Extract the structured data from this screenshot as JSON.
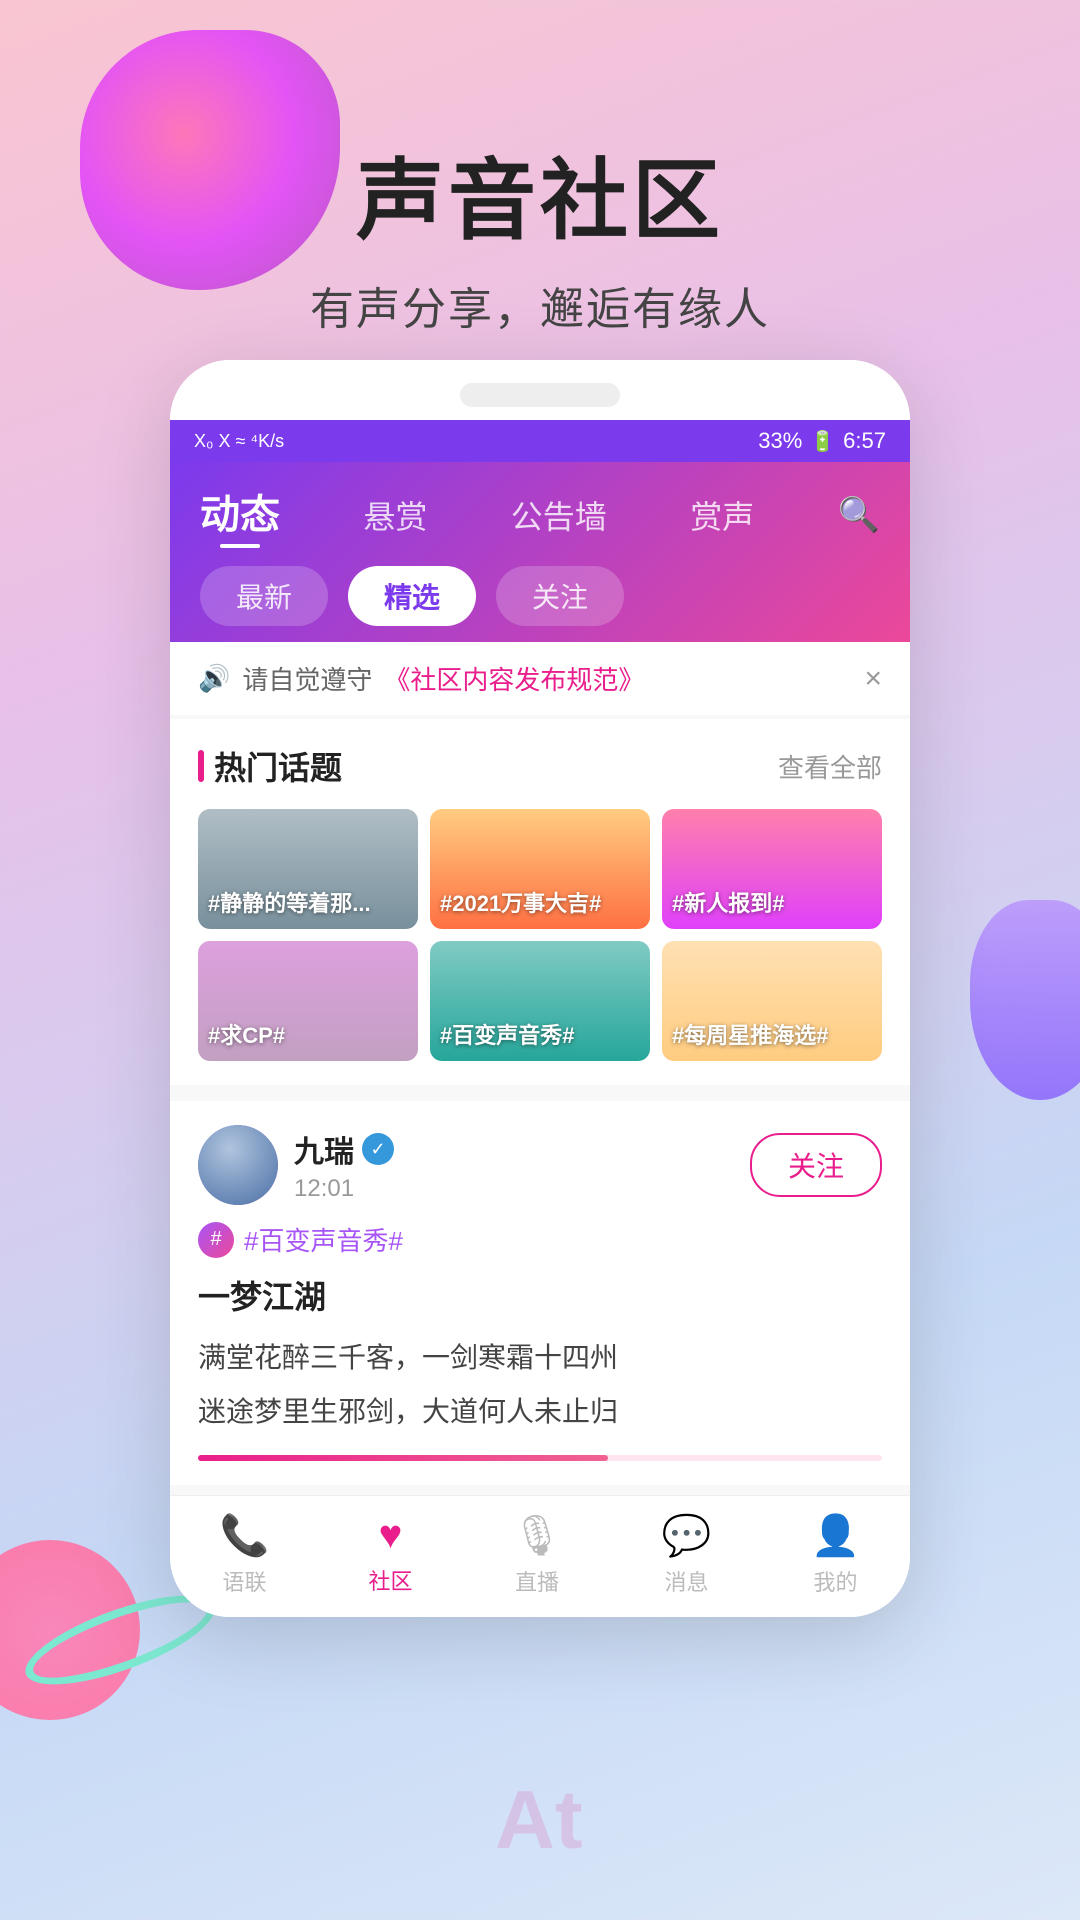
{
  "background": {
    "gradient": "linear-gradient(160deg, #f9c5d1 0%, #e8c0e8 30%, #c5d8f5 70%, #dce8f8 100%)"
  },
  "hero": {
    "title": "声音社区",
    "subtitle": "有声分享，邂逅有缘人"
  },
  "status_bar": {
    "left_icons": "X₀ X ≈ ⁴K/s",
    "battery": "33%",
    "time": "6:57"
  },
  "header": {
    "tabs": [
      {
        "id": "dongtai",
        "label": "动态",
        "active": true
      },
      {
        "id": "xueshang",
        "label": "悬赏",
        "active": false
      },
      {
        "id": "gaoboqiang",
        "label": "公告墙",
        "active": false
      },
      {
        "id": "shangsheng",
        "label": "赏声",
        "active": false
      }
    ],
    "search_icon": "🔍"
  },
  "filter_pills": [
    {
      "id": "zuixin",
      "label": "最新",
      "selected": false
    },
    {
      "id": "jingxuan",
      "label": "精选",
      "selected": true
    },
    {
      "id": "guanzhu",
      "label": "关注",
      "selected": false
    }
  ],
  "notice": {
    "icon": "🔊",
    "prefix": "请自觉遵守",
    "link_text": "《社区内容发布规范》",
    "close_icon": "×"
  },
  "hot_topics": {
    "title": "热门话题",
    "view_all": "查看全部",
    "items": [
      {
        "id": 1,
        "label": "#静静的等着那..."
      },
      {
        "id": 2,
        "label": "#2021万事大吉#"
      },
      {
        "id": 3,
        "label": "#新人报到#"
      },
      {
        "id": 4,
        "label": "#求CP#"
      },
      {
        "id": 5,
        "label": "#百变声音秀#"
      },
      {
        "id": 6,
        "label": "#每周星推海选#"
      }
    ]
  },
  "post": {
    "user": {
      "name": "九瑞",
      "verified": true,
      "avatar_color": "#667eea",
      "time": "12:01"
    },
    "follow_label": "关注",
    "tag": "#百变声音秀#",
    "title": "一梦江湖",
    "content_lines": [
      "满堂花醉三千客，一剑寒霜十四州",
      "迷途梦里生邪剑，大道何人未止归"
    ]
  },
  "bottom_nav": {
    "items": [
      {
        "id": "yulian",
        "label": "语联",
        "icon": "📞",
        "active": false
      },
      {
        "id": "shequ",
        "label": "社区",
        "icon": "♥",
        "active": true
      },
      {
        "id": "zhibo",
        "label": "直播",
        "icon": "🎙",
        "active": false
      },
      {
        "id": "xiaoxi",
        "label": "消息",
        "icon": "💬",
        "active": false
      },
      {
        "id": "wode",
        "label": "我的",
        "icon": "👤",
        "active": false
      }
    ]
  }
}
